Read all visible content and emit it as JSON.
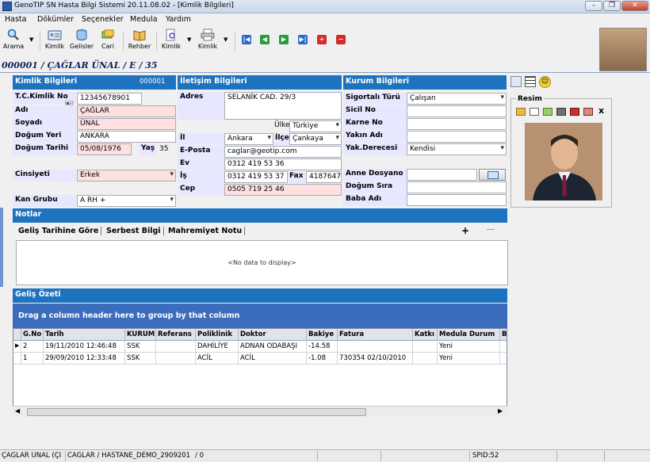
{
  "window": {
    "title": "GenoTIP SN Hasta Bilgi Sistemi  20.11.08.02 - [Kimlik Bilgileri]"
  },
  "menu": [
    "Hasta",
    "Dökümler",
    "Seçenekler",
    "Medula",
    "Yardım"
  ],
  "toolbar": {
    "arama": "Arama",
    "kimlik": "Kimlik",
    "gelisler": "Gelisler",
    "cari": "Cari",
    "rehber": "Rehber",
    "kimlik2": "Kimlik",
    "kimlik3": "Kimlik"
  },
  "record_title": "000001 / ÇAĞLAR ÜNAL / E / 35",
  "kimlik": {
    "header": "Kimlik Bilgileri",
    "id": "000001",
    "tc_label": "T.C.Kimlik No",
    "tc": "12345678901",
    "adi_label": "Adı",
    "adi": "ÇAĞLAR",
    "soyadi_label": "Soyadı",
    "soyadi": "ÜNAL",
    "dogum_yeri_label": "Doğum Yeri",
    "dogum_yeri": "ANKARA",
    "dogum_tarihi_label": "Doğum Tarihi",
    "dogum_tarihi": "05/08/1976",
    "yas_label": "Yaş",
    "yas": "35",
    "cinsiyet_label": "Cinsiyeti",
    "cinsiyet": "Erkek",
    "kan_label": "Kan Grubu",
    "kan": "A RH +"
  },
  "iletisim": {
    "header": "İletişim Bilgileri",
    "adres_label": "Adres",
    "adres": "SELANİK CAD. 29/3",
    "ulke_label": "Ülke",
    "ulke": "Türkiye",
    "il_label": "İl",
    "il": "Ankara",
    "ilce_label": "İlçe",
    "ilce": "Çankaya",
    "eposta_label": "E-Posta",
    "eposta": "caglar@geotip.com",
    "ev_label": "Ev",
    "ev": "0312 419 53 36",
    "is_label": "İş",
    "is": "0312 419 53 37",
    "fax_label": "Fax",
    "fax": "4187647",
    "cep_label": "Cep",
    "cep": "0505 719 25 46"
  },
  "kurum": {
    "header": "Kurum Bilgileri",
    "sigorta_label": "Sigortalı Türü",
    "sigorta": "Çalışan",
    "sicil_label": "Sicil No",
    "karne_label": "Karne No",
    "yakin_label": "Yakın Adı",
    "yak_derece_label": "Yak.Derecesi",
    "yak_derece": "Kendisi",
    "anne_label": "Anne Dosyano",
    "dogum_sira_label": "Doğum Sıra",
    "baba_label": "Baba Adı"
  },
  "resim": {
    "label": "Resim",
    "close": "x"
  },
  "notlar": {
    "header": "Notlar",
    "tabs": [
      "Geliş Tarihine Göre",
      "Serbest Bilgi",
      "Mahremiyet Notu"
    ],
    "add": "+",
    "empty": "<No data to display>"
  },
  "gelis": {
    "header": "Geliş Özeti",
    "group_hint": "Drag a column header here to group by that column",
    "columns": [
      "G.No",
      "Tarih",
      "KURUM",
      "Referans",
      "Poliklinik",
      "Doktor",
      "Bakiye",
      "Fatura",
      "Katkı",
      "Medula Durum",
      "B"
    ],
    "rows": [
      [
        "2",
        "19/11/2010 12:46:48",
        "SSK",
        "",
        "DAHİLİYE",
        "ADNAN ODABAŞI",
        "-14.58",
        "",
        "",
        "Yeni",
        ""
      ],
      [
        "1",
        "29/09/2010 12:33:48",
        "SSK",
        "",
        "ACİL",
        "ACİL",
        "-1.08",
        "730354 02/10/2010",
        "",
        "Yeni",
        ""
      ]
    ]
  },
  "status": {
    "user": "ÇAĞLAR ÜNAL (Çİ",
    "info": "CAGLAR / HASTANE_DEMO_2909201",
    "count": "/ 0",
    "spid": "SPID:52"
  },
  "colors": {
    "section_header": "#1e73bf",
    "label_bg": "#e7e7ff",
    "required_bg": "#ffe0e0",
    "grid_group_panel": "#3c6cbc"
  }
}
